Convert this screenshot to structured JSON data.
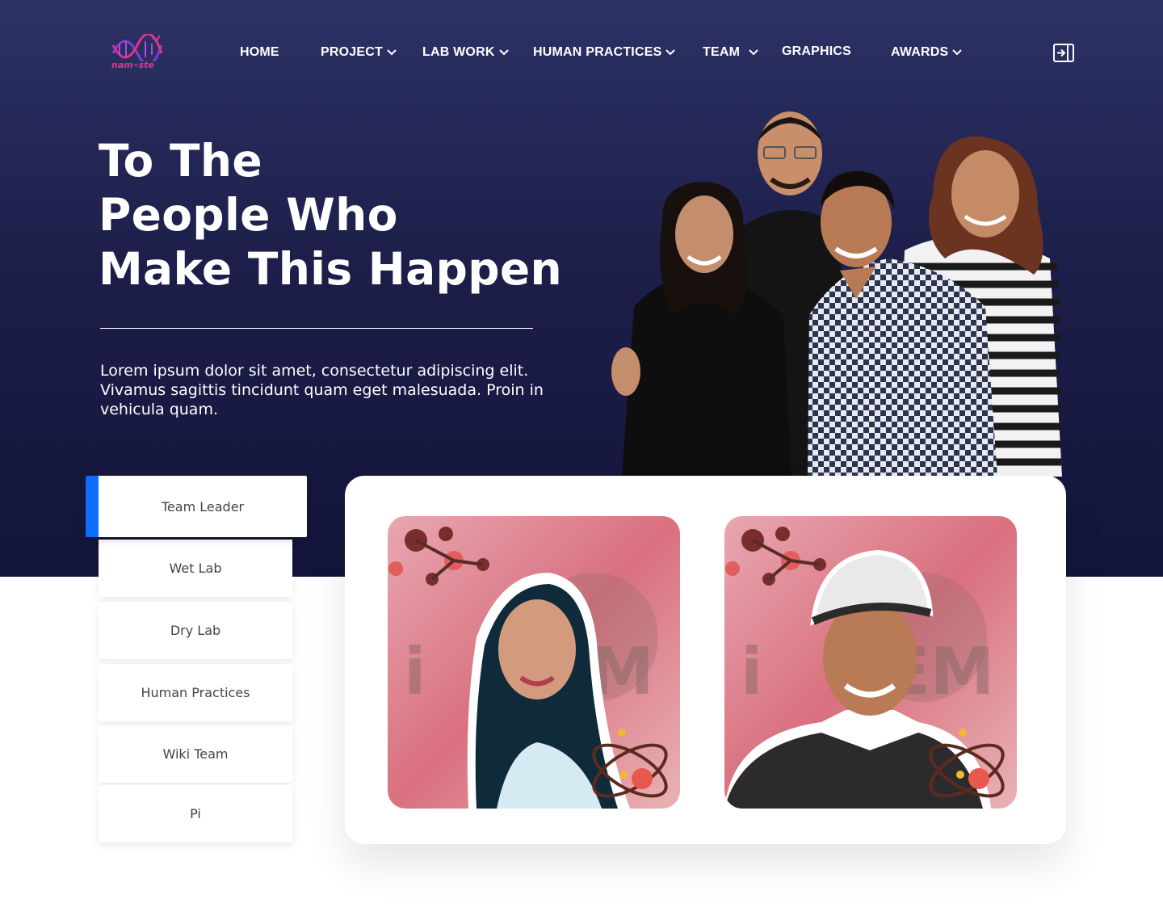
{
  "nav": {
    "logo_text": "nam∘ste",
    "items": [
      {
        "label": "HOME",
        "has_dropdown": false
      },
      {
        "label": "PROJECT",
        "has_dropdown": true
      },
      {
        "label": "LAB WORK",
        "has_dropdown": true
      },
      {
        "label": "HUMAN PRACTICES",
        "has_dropdown": true
      },
      {
        "label": "TEAM",
        "has_dropdown": true
      },
      {
        "label": "GRAPHICS",
        "has_dropdown": false
      },
      {
        "label": "AWARDS",
        "has_dropdown": true
      }
    ],
    "login_icon": "login-icon"
  },
  "hero": {
    "title_lines": [
      "To The",
      "People Who",
      "Make This Happen"
    ],
    "description": "Lorem ipsum dolor sit amet, consectetur adipiscing elit. Vivamus sagittis tincidunt quam eget malesuada. Proin in vehicula quam."
  },
  "team_menu": {
    "items": [
      "Team Leader",
      "Wet Lab",
      "Dry Lab",
      "Human Practices",
      "Wiki Team",
      "Pi"
    ],
    "active_index": 0
  },
  "colors": {
    "hero_top": "#2d3265",
    "hero_bottom": "#12143a",
    "accent": "#0d6efd",
    "logo_pink": "#e0338d",
    "logo_purple": "#7b3fd1"
  }
}
